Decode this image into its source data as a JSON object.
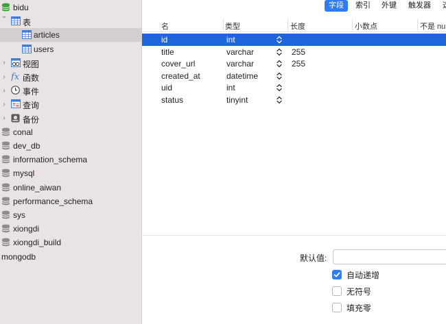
{
  "sidebar": {
    "items": [
      {
        "label": "bidu",
        "icon": "database-icon",
        "indent": 0,
        "chevron": false,
        "selected": false
      },
      {
        "label": "表",
        "icon": "table-group-icon",
        "indent": 1,
        "chevron": "down",
        "selected": false
      },
      {
        "label": "articles",
        "icon": "table-icon",
        "indent": 2,
        "chevron": false,
        "selected": true
      },
      {
        "label": "users",
        "icon": "table-icon",
        "indent": 2,
        "chevron": false,
        "selected": false
      },
      {
        "label": "视图",
        "icon": "view-icon",
        "indent": 1,
        "chevron": "right",
        "selected": false
      },
      {
        "label": "函数",
        "icon": "function-icon",
        "indent": 1,
        "chevron": "right",
        "selected": false
      },
      {
        "label": "事件",
        "icon": "event-clock-icon",
        "indent": 1,
        "chevron": "right",
        "selected": false
      },
      {
        "label": "查询",
        "icon": "query-icon",
        "indent": 1,
        "chevron": "right",
        "selected": false
      },
      {
        "label": "备份",
        "icon": "backup-icon",
        "indent": 1,
        "chevron": "right",
        "selected": false
      },
      {
        "label": "conal",
        "icon": "database-icon",
        "indent": 0,
        "chevron": false,
        "selected": false
      },
      {
        "label": "dev_db",
        "icon": "database-icon",
        "indent": 0,
        "chevron": false,
        "selected": false
      },
      {
        "label": "information_schema",
        "icon": "database-icon",
        "indent": 0,
        "chevron": false,
        "selected": false
      },
      {
        "label": "mysql",
        "icon": "database-icon",
        "indent": 0,
        "chevron": false,
        "selected": false
      },
      {
        "label": "online_aiwan",
        "icon": "database-icon",
        "indent": 0,
        "chevron": false,
        "selected": false
      },
      {
        "label": "performance_schema",
        "icon": "database-icon",
        "indent": 0,
        "chevron": false,
        "selected": false
      },
      {
        "label": "sys",
        "icon": "database-icon",
        "indent": 0,
        "chevron": false,
        "selected": false
      },
      {
        "label": "xiongdi",
        "icon": "database-icon",
        "indent": 0,
        "chevron": false,
        "selected": false
      },
      {
        "label": "xiongdi_build",
        "icon": "database-icon",
        "indent": 0,
        "chevron": false,
        "selected": false
      },
      {
        "label": "mongodb",
        "icon": "",
        "indent": 0,
        "chevron": false,
        "selected": false
      }
    ]
  },
  "toolbar": {
    "tabs": [
      {
        "label": "字段",
        "active": true
      },
      {
        "label": "索引",
        "active": false
      },
      {
        "label": "外键",
        "active": false
      },
      {
        "label": "触发器",
        "active": false
      },
      {
        "label": "选",
        "active": false
      }
    ]
  },
  "grid": {
    "columns": [
      "名",
      "类型",
      "长度",
      "小数点",
      "不是 null"
    ],
    "rows": [
      {
        "name": "id",
        "type": "int",
        "length": "",
        "selected": true
      },
      {
        "name": "title",
        "type": "varchar",
        "length": "255",
        "selected": false
      },
      {
        "name": "cover_url",
        "type": "varchar",
        "length": "255",
        "selected": false
      },
      {
        "name": "created_at",
        "type": "datetime",
        "length": "",
        "selected": false
      },
      {
        "name": "uid",
        "type": "int",
        "length": "",
        "selected": false
      },
      {
        "name": "status",
        "type": "tinyint",
        "length": "",
        "selected": false
      }
    ]
  },
  "properties": {
    "default_label": "默认值:",
    "default_value": "",
    "auto_increment": {
      "label": "自动递增",
      "checked": true
    },
    "unsigned": {
      "label": "无符号",
      "checked": false
    },
    "zerofill": {
      "label": "填充零",
      "checked": false
    }
  },
  "colors": {
    "accent": "#2f7df6",
    "selected_row": "#1f66dd",
    "db_icon": "#8c8c8c",
    "bidu_icon": "#3ba534"
  }
}
